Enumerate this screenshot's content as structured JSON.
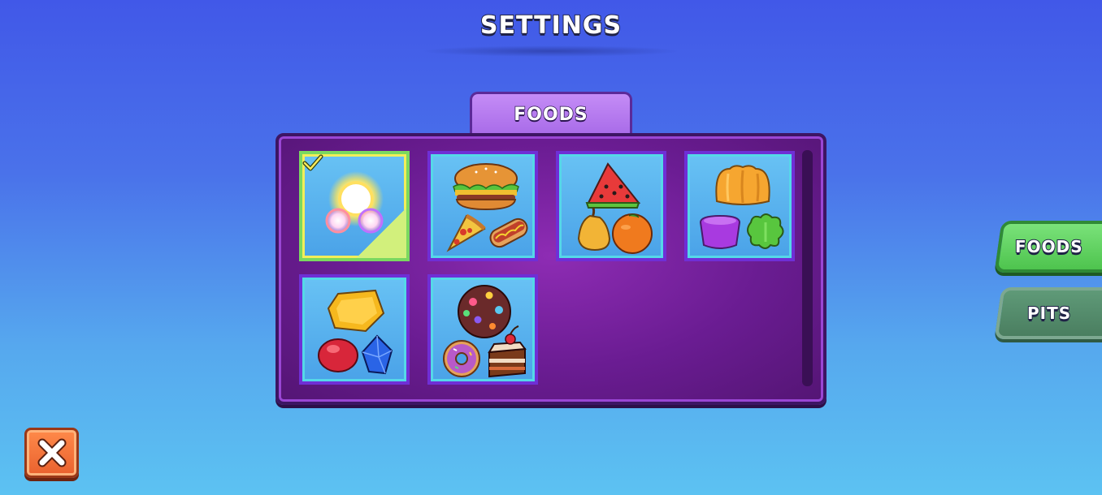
{
  "header": {
    "title": "SETTINGS"
  },
  "panel": {
    "tab_label": "FOODS",
    "items": [
      {
        "id": "glow-orbs",
        "icon": "glowing-orbs-icon",
        "selected": true
      },
      {
        "id": "fast-food",
        "icon": "burger-pizza-hotdog-icon",
        "selected": false
      },
      {
        "id": "fruits",
        "icon": "watermelon-pear-orange-icon",
        "selected": false
      },
      {
        "id": "jelly",
        "icon": "jelly-pudding-icon",
        "selected": false
      },
      {
        "id": "gems",
        "icon": "gems-icon",
        "selected": false
      },
      {
        "id": "sweets",
        "icon": "cookie-donut-cake-icon",
        "selected": false
      }
    ]
  },
  "side_tabs": [
    {
      "label": "FOODS",
      "active": true
    },
    {
      "label": "PITS",
      "active": false
    }
  ],
  "close_button": {
    "icon": "close-x-icon"
  },
  "colors": {
    "panel_purple": "#6a1c92",
    "card_blue": "#4aa2e8",
    "active_green": "#4ec44e",
    "inactive_green": "#4a7e60",
    "close_orange": "#e9612e"
  }
}
